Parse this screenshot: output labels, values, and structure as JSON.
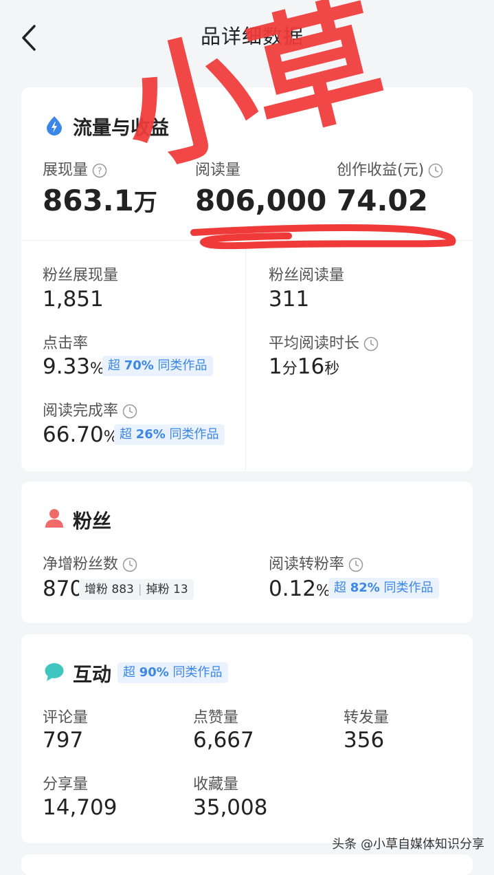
{
  "header": {
    "title": "品详细数据"
  },
  "traffic": {
    "title": "流量与收益",
    "impressions": {
      "label": "展现量",
      "value_num": "863.1",
      "value_unit": "万"
    },
    "reads": {
      "label": "阅读量",
      "value": "806,000"
    },
    "earnings": {
      "label": "创作收益(元)",
      "value": "74.02"
    },
    "fan_impressions": {
      "label": "粉丝展现量",
      "value": "1,851"
    },
    "fan_reads": {
      "label": "粉丝阅读量",
      "value": "311"
    },
    "ctr": {
      "label": "点击率",
      "value_num": "9.33",
      "value_unit": "%",
      "badge_pre": "超 ",
      "badge_pct": "70%",
      "badge_post": " 同类作品"
    },
    "avg_read_time": {
      "label": "平均阅读时长",
      "min": "1",
      "min_unit": "分",
      "sec": "16",
      "sec_unit": "秒"
    },
    "completion": {
      "label": "阅读完成率",
      "value_num": "66.70",
      "value_unit": "%",
      "badge_pre": "超 ",
      "badge_pct": "26%",
      "badge_post": " 同类作品"
    }
  },
  "fans": {
    "title": "粉丝",
    "net": {
      "label": "净增粉丝数",
      "value": "870",
      "gain_label": "增粉",
      "gain": "883",
      "loss_label": "掉粉",
      "loss": "13"
    },
    "conv": {
      "label": "阅读转粉率",
      "value_num": "0.12",
      "value_unit": "%",
      "badge_pre": "超 ",
      "badge_pct": "82%",
      "badge_post": " 同类作品"
    }
  },
  "interaction": {
    "title": "互动",
    "badge_pre": "超 ",
    "badge_pct": "90%",
    "badge_post": " 同类作品",
    "comments": {
      "label": "评论量",
      "value": "797"
    },
    "likes": {
      "label": "点赞量",
      "value": "6,667"
    },
    "forwards": {
      "label": "转发量",
      "value": "356"
    },
    "shares": {
      "label": "分享量",
      "value": "14,709"
    },
    "favorites": {
      "label": "收藏量",
      "value": "35,008"
    }
  },
  "overlay": {
    "stamp_text": "小草"
  },
  "watermark": "头条 @小草自媒体知识分享",
  "icons": [
    "back-arrow-icon",
    "lightning-drop-icon",
    "question-icon",
    "clock-icon",
    "person-icon",
    "chat-bubble-icon"
  ],
  "colors": {
    "accent_blue": "#3b86e6",
    "badge_bg": "#eaf2fd",
    "fans_red": "#f06a6a",
    "chat_teal": "#3fc6c0",
    "stamp_red": "#f03a3a"
  }
}
